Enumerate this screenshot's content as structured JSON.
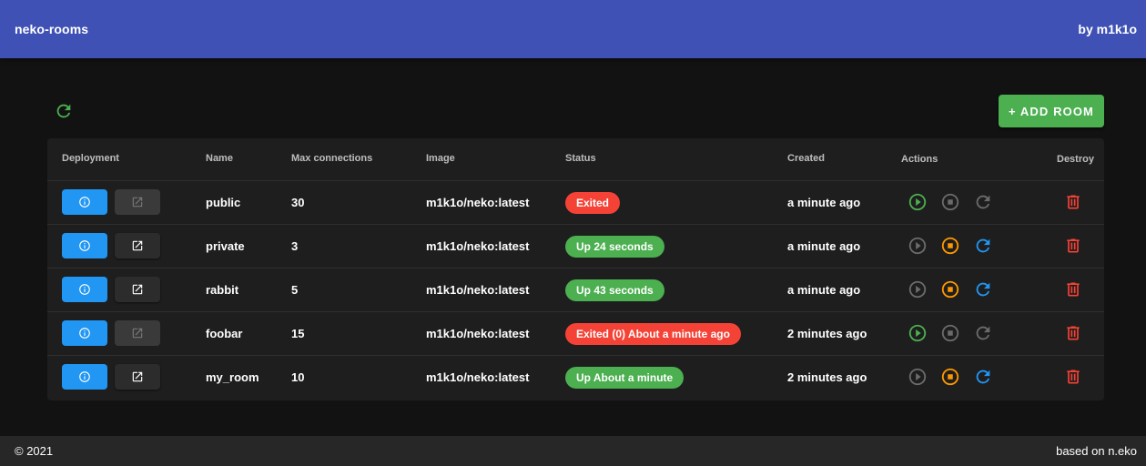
{
  "app": {
    "title": "neko-rooms",
    "author": "by m1k1o"
  },
  "toolbar": {
    "refresh_icon": "refresh-icon",
    "add_room_label": "+ ADD ROOM"
  },
  "colors": {
    "appbar": "#3f51b5",
    "accent_green": "#4caf50",
    "info_blue": "#2196f3",
    "danger_red": "#f44336",
    "stop_orange": "#ff9800"
  },
  "table": {
    "headers": {
      "deployment": "Deployment",
      "name": "Name",
      "max_connections": "Max connections",
      "image": "Image",
      "status": "Status",
      "created": "Created",
      "actions": "Actions",
      "destroy": "Destroy"
    },
    "rows": [
      {
        "name": "public",
        "max_connections": "30",
        "image": "m1k1o/neko:latest",
        "status": "Exited",
        "status_color": "red",
        "created": "a minute ago",
        "running": false
      },
      {
        "name": "private",
        "max_connections": "3",
        "image": "m1k1o/neko:latest",
        "status": "Up 24 seconds",
        "status_color": "green",
        "created": "a minute ago",
        "running": true
      },
      {
        "name": "rabbit",
        "max_connections": "5",
        "image": "m1k1o/neko:latest",
        "status": "Up 43 seconds",
        "status_color": "green",
        "created": "a minute ago",
        "running": true
      },
      {
        "name": "foobar",
        "max_connections": "15",
        "image": "m1k1o/neko:latest",
        "status": "Exited (0) About a minute ago",
        "status_color": "red",
        "created": "2 minutes ago",
        "running": false
      },
      {
        "name": "my_room",
        "max_connections": "10",
        "image": "m1k1o/neko:latest",
        "status": "Up About a minute",
        "status_color": "green",
        "created": "2 minutes ago",
        "running": true
      }
    ]
  },
  "footer": {
    "copyright": "© 2021",
    "credit": "based on n.eko"
  }
}
